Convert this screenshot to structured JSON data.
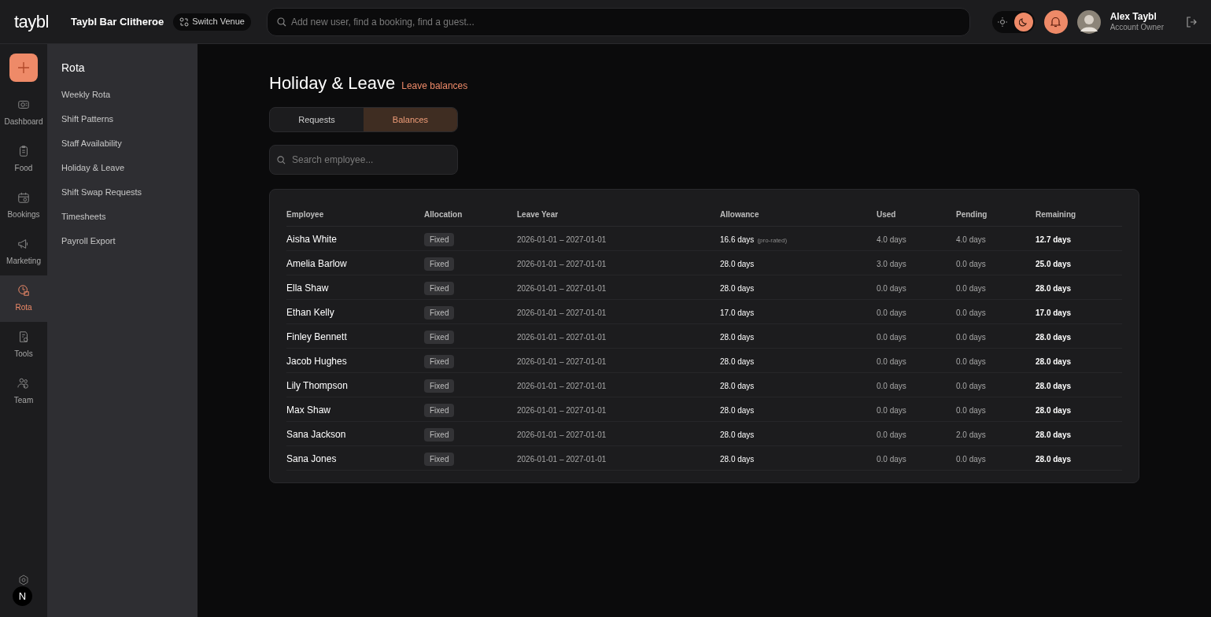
{
  "header": {
    "logo": "taybl",
    "venue": "Taybl Bar Clitheroe",
    "switch_venue": "Switch Venue",
    "search": {
      "placeholder": "Add new user, find a booking, find a guest..."
    },
    "theme": {
      "dark": true
    },
    "user": {
      "name": "Alex Taybl",
      "role": "Account Owner"
    }
  },
  "rail": {
    "items": [
      {
        "label": "Dashboard",
        "selected": false
      },
      {
        "label": "Food",
        "selected": false
      },
      {
        "label": "Bookings",
        "selected": false
      },
      {
        "label": "Marketing",
        "selected": false
      },
      {
        "label": "Rota",
        "selected": true
      },
      {
        "label": "Tools",
        "selected": false
      },
      {
        "label": "Team",
        "selected": false
      }
    ],
    "dev_badge": "N"
  },
  "submenu": {
    "title": "Rota",
    "items": [
      "Weekly Rota",
      "Shift Patterns",
      "Staff Availability",
      "Holiday & Leave",
      "Shift Swap Requests",
      "Timesheets",
      "Payroll Export"
    ]
  },
  "page": {
    "title": "Holiday & Leave",
    "subtitle": "Leave balances",
    "tabs": [
      {
        "label": "Requests",
        "selected": false
      },
      {
        "label": "Balances",
        "selected": true
      }
    ],
    "search": {
      "placeholder": "Search employee..."
    },
    "table": {
      "columns": [
        "Employee",
        "Allocation",
        "Leave Year",
        "Allowance",
        "Used",
        "Pending",
        "Remaining"
      ],
      "rows": [
        {
          "employee": "Aisha White",
          "allocation": "Fixed",
          "leave_year": "2026-01-01 – 2027-01-01",
          "allowance": "16.6 days",
          "allowance_note": "(pro-rated)",
          "used": "4.0 days",
          "pending": "4.0 days",
          "remaining": "12.7 days"
        },
        {
          "employee": "Amelia Barlow",
          "allocation": "Fixed",
          "leave_year": "2026-01-01 – 2027-01-01",
          "allowance": "28.0 days",
          "used": "3.0 days",
          "pending": "0.0 days",
          "remaining": "25.0 days"
        },
        {
          "employee": "Ella Shaw",
          "allocation": "Fixed",
          "leave_year": "2026-01-01 – 2027-01-01",
          "allowance": "28.0 days",
          "used": "0.0 days",
          "pending": "0.0 days",
          "remaining": "28.0 days"
        },
        {
          "employee": "Ethan Kelly",
          "allocation": "Fixed",
          "leave_year": "2026-01-01 – 2027-01-01",
          "allowance": "17.0 days",
          "used": "0.0 days",
          "pending": "0.0 days",
          "remaining": "17.0 days"
        },
        {
          "employee": "Finley Bennett",
          "allocation": "Fixed",
          "leave_year": "2026-01-01 – 2027-01-01",
          "allowance": "28.0 days",
          "used": "0.0 days",
          "pending": "0.0 days",
          "remaining": "28.0 days"
        },
        {
          "employee": "Jacob Hughes",
          "allocation": "Fixed",
          "leave_year": "2026-01-01 – 2027-01-01",
          "allowance": "28.0 days",
          "used": "0.0 days",
          "pending": "0.0 days",
          "remaining": "28.0 days"
        },
        {
          "employee": "Lily Thompson",
          "allocation": "Fixed",
          "leave_year": "2026-01-01 – 2027-01-01",
          "allowance": "28.0 days",
          "used": "0.0 days",
          "pending": "0.0 days",
          "remaining": "28.0 days"
        },
        {
          "employee": "Max Shaw",
          "allocation": "Fixed",
          "leave_year": "2026-01-01 – 2027-01-01",
          "allowance": "28.0 days",
          "used": "0.0 days",
          "pending": "0.0 days",
          "remaining": "28.0 days"
        },
        {
          "employee": "Sana Jackson",
          "allocation": "Fixed",
          "leave_year": "2026-01-01 – 2027-01-01",
          "allowance": "28.0 days",
          "used": "0.0 days",
          "pending": "2.0 days",
          "remaining": "28.0 days"
        },
        {
          "employee": "Sana Jones",
          "allocation": "Fixed",
          "leave_year": "2026-01-01 – 2027-01-01",
          "allowance": "28.0 days",
          "used": "0.0 days",
          "pending": "0.0 days",
          "remaining": "28.0 days"
        }
      ]
    }
  }
}
